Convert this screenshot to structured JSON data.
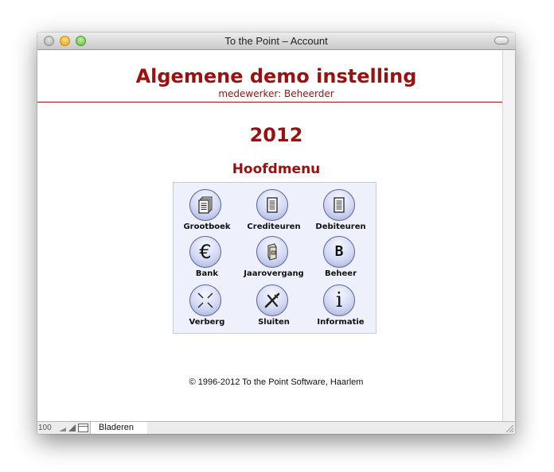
{
  "window": {
    "title": "To the Point – Account"
  },
  "header": {
    "title": "Algemene demo instelling",
    "subtitle": "medewerker: Beheerder"
  },
  "main": {
    "year": "2012",
    "menu_title": "Hoofdmenu",
    "items": [
      {
        "label": "Grootboek",
        "icon": "ledger-stack-icon"
      },
      {
        "label": "Crediteuren",
        "icon": "document-icon"
      },
      {
        "label": "Debiteuren",
        "icon": "document-icon"
      },
      {
        "label": "Bank",
        "icon": "euro-icon"
      },
      {
        "label": "Jaarovergang",
        "icon": "year-transition-icon"
      },
      {
        "label": "Beheer",
        "icon": "b-icon"
      },
      {
        "label": "Verberg",
        "icon": "hide-icon"
      },
      {
        "label": "Sluiten",
        "icon": "close-x-icon"
      },
      {
        "label": "Informatie",
        "icon": "info-icon"
      }
    ],
    "glyphs": {
      "euro": "€",
      "b": "B",
      "info": "i"
    }
  },
  "footer": {
    "copyright": "© 1996-2012  To the Point Software, Haarlem"
  },
  "statusbar": {
    "zoom": "100",
    "mode": "Bladeren"
  },
  "colors": {
    "accent": "#9c1010",
    "panel": "#eef0fb",
    "panel_border": "#c5c9ea"
  }
}
